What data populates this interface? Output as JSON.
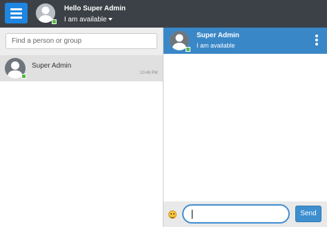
{
  "header": {
    "greeting": "Hello Super Admin",
    "status_label": "I am available",
    "icons": {
      "menu": "hamburger-menu-icon",
      "status_caret": "caret-down-icon"
    },
    "colors": {
      "bar": "#3c4147",
      "menu_button": "#1e86e0",
      "online": "#58b947"
    }
  },
  "sidebar": {
    "search": {
      "placeholder": "Find a person or group",
      "value": ""
    },
    "contacts": [
      {
        "name": "Super Admin",
        "time": "10:46 PM",
        "online": true
      }
    ]
  },
  "chat": {
    "contact_name": "Super Admin",
    "contact_status": "I am available",
    "header_color": "#3a87c8",
    "icons": {
      "options": "more-vertical-icon",
      "emoji": "emoji-icon"
    },
    "composer": {
      "value": "",
      "send_label": "Send"
    }
  }
}
